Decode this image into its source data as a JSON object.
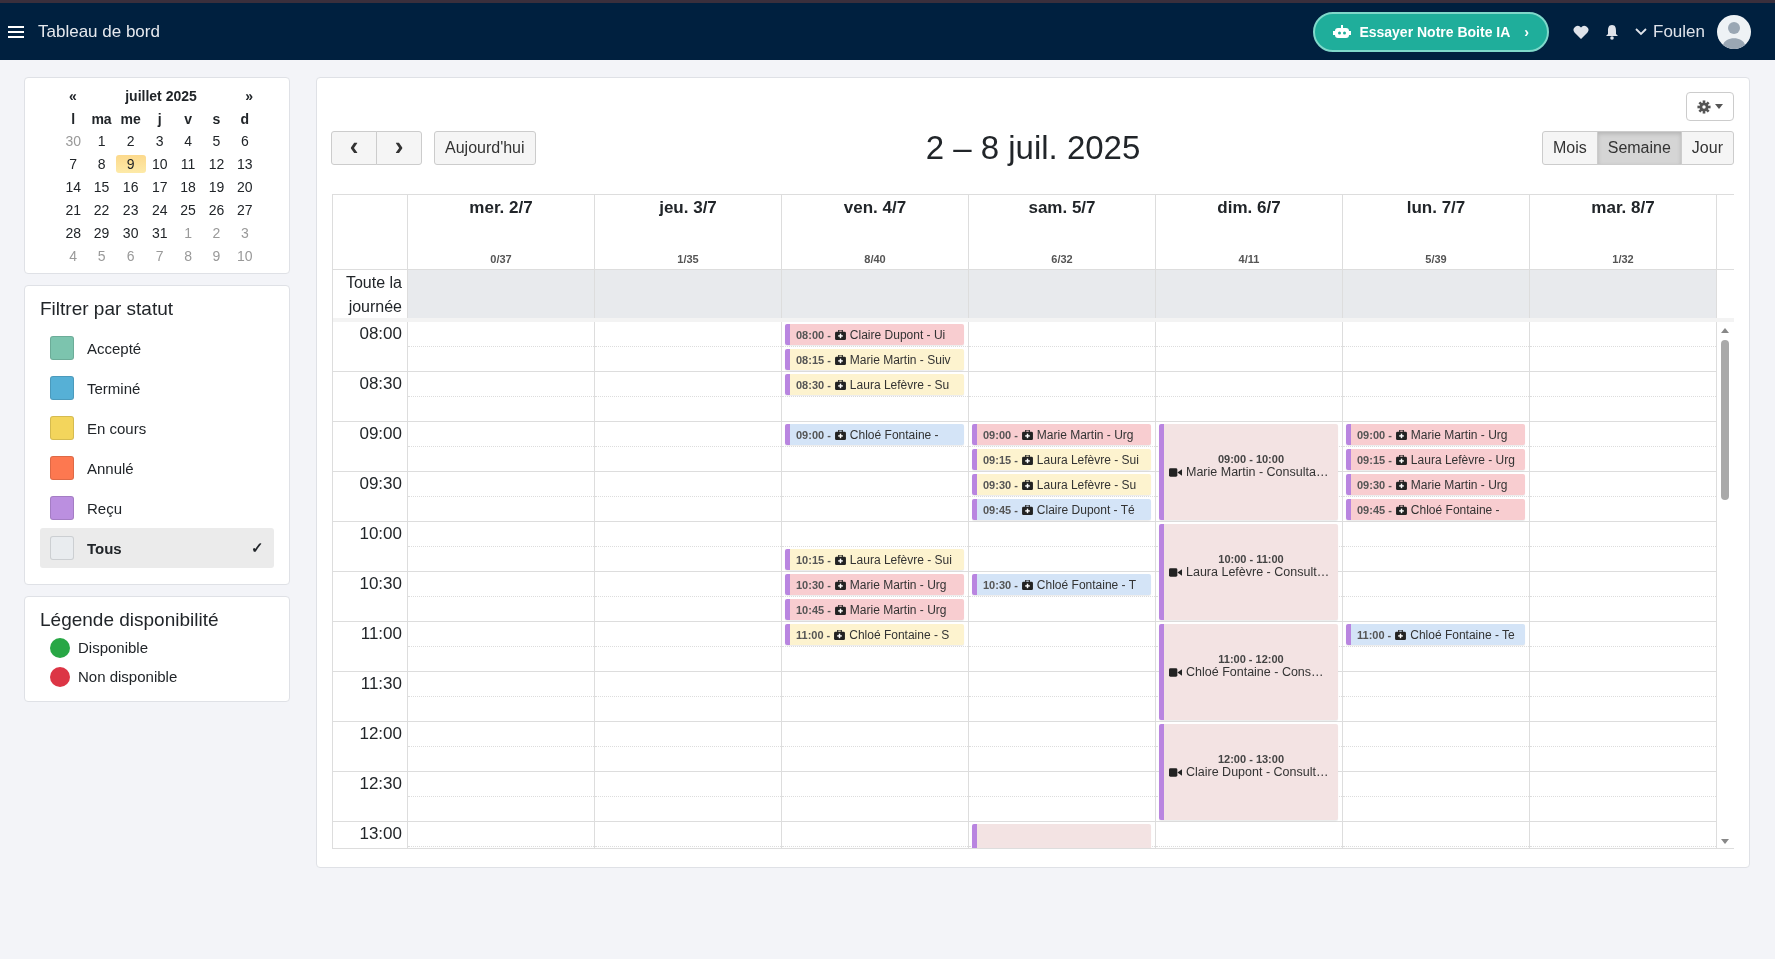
{
  "topbar": {
    "title": "Tableau de bord",
    "ai_button": "Essayer Notre Boite IA",
    "ai_chevron": "›",
    "user": "Foulen"
  },
  "mini_calendar": {
    "prev": "«",
    "title": "juillet 2025",
    "next": "»",
    "weekdays": [
      "l",
      "ma",
      "me",
      "j",
      "v",
      "s",
      "d"
    ],
    "weeks": [
      [
        {
          "day": "30",
          "muted": true,
          "selected": false
        },
        {
          "day": "1",
          "muted": false,
          "selected": false
        },
        {
          "day": "2",
          "muted": false,
          "selected": false
        },
        {
          "day": "3",
          "muted": false,
          "selected": false
        },
        {
          "day": "4",
          "muted": false,
          "selected": false
        },
        {
          "day": "5",
          "muted": false,
          "selected": false
        },
        {
          "day": "6",
          "muted": false,
          "selected": false
        }
      ],
      [
        {
          "day": "7",
          "muted": false,
          "selected": false
        },
        {
          "day": "8",
          "muted": false,
          "selected": false
        },
        {
          "day": "9",
          "muted": false,
          "selected": true
        },
        {
          "day": "10",
          "muted": false,
          "selected": false
        },
        {
          "day": "11",
          "muted": false,
          "selected": false
        },
        {
          "day": "12",
          "muted": false,
          "selected": false
        },
        {
          "day": "13",
          "muted": false,
          "selected": false
        }
      ],
      [
        {
          "day": "14",
          "muted": false,
          "selected": false
        },
        {
          "day": "15",
          "muted": false,
          "selected": false
        },
        {
          "day": "16",
          "muted": false,
          "selected": false
        },
        {
          "day": "17",
          "muted": false,
          "selected": false
        },
        {
          "day": "18",
          "muted": false,
          "selected": false
        },
        {
          "day": "19",
          "muted": false,
          "selected": false
        },
        {
          "day": "20",
          "muted": false,
          "selected": false
        }
      ],
      [
        {
          "day": "21",
          "muted": false,
          "selected": false
        },
        {
          "day": "22",
          "muted": false,
          "selected": false
        },
        {
          "day": "23",
          "muted": false,
          "selected": false
        },
        {
          "day": "24",
          "muted": false,
          "selected": false
        },
        {
          "day": "25",
          "muted": false,
          "selected": false
        },
        {
          "day": "26",
          "muted": false,
          "selected": false
        },
        {
          "day": "27",
          "muted": false,
          "selected": false
        }
      ],
      [
        {
          "day": "28",
          "muted": false,
          "selected": false
        },
        {
          "day": "29",
          "muted": false,
          "selected": false
        },
        {
          "day": "30",
          "muted": false,
          "selected": false
        },
        {
          "day": "31",
          "muted": false,
          "selected": false
        },
        {
          "day": "1",
          "muted": true,
          "selected": false
        },
        {
          "day": "2",
          "muted": true,
          "selected": false
        },
        {
          "day": "3",
          "muted": true,
          "selected": false
        }
      ],
      [
        {
          "day": "4",
          "muted": true,
          "selected": false
        },
        {
          "day": "5",
          "muted": true,
          "selected": false
        },
        {
          "day": "6",
          "muted": true,
          "selected": false
        },
        {
          "day": "7",
          "muted": true,
          "selected": false
        },
        {
          "day": "8",
          "muted": true,
          "selected": false
        },
        {
          "day": "9",
          "muted": true,
          "selected": false
        },
        {
          "day": "10",
          "muted": true,
          "selected": false
        }
      ]
    ]
  },
  "status_filter": {
    "title": "Filtrer par statut",
    "items": [
      {
        "label": "Accepté",
        "color": "#7cc4ae",
        "selected": false
      },
      {
        "label": "Terminé",
        "color": "#56b0d6",
        "selected": false
      },
      {
        "label": "En cours",
        "color": "#f3d55c",
        "selected": false
      },
      {
        "label": "Annulé",
        "color": "#fd7850",
        "selected": false
      },
      {
        "label": "Reçu",
        "color": "#bb8fe0",
        "selected": false
      },
      {
        "label": "Tous",
        "color": "#e9ecef",
        "selected": true,
        "check": "✓"
      }
    ]
  },
  "availability_legend": {
    "title": "Légende disponibilité",
    "items": [
      {
        "label": "Disponible",
        "color": "#28a745"
      },
      {
        "label": "Non disponible",
        "color": "#dc3545"
      }
    ]
  },
  "calendar": {
    "prev": "‹",
    "next": "›",
    "today": "Aujourd'hui",
    "title": "2 – 8 juil. 2025",
    "views": [
      {
        "label": "Mois",
        "selected": false
      },
      {
        "label": "Semaine",
        "selected": true
      },
      {
        "label": "Jour",
        "selected": false
      }
    ],
    "all_day_label": "Toute la journée",
    "times": [
      "08:00",
      "08:30",
      "09:00",
      "09:30",
      "10:00",
      "10:30",
      "11:00",
      "11:30",
      "12:00",
      "12:30",
      "13:00"
    ],
    "days": [
      {
        "name": "mer. 2/7",
        "count": "0/37"
      },
      {
        "name": "jeu. 3/7",
        "count": "1/35"
      },
      {
        "name": "ven. 4/7",
        "count": "8/40",
        "events": [
          {
            "kind": "short",
            "time": "08:00 -",
            "title": "Claire Dupont - Ui",
            "color": "#f8cdd0"
          },
          {
            "kind": "short",
            "time": "08:15 -",
            "title": "Marie Martin - Suiv",
            "color": "#fdf3cf"
          },
          {
            "kind": "short",
            "time": "08:30 -",
            "title": "Laura Lefèvre - Su",
            "color": "#fdf3cf"
          },
          {
            "kind": "short",
            "time": "09:00 -",
            "title": "Chloé Fontaine -",
            "color": "#d4e4f7"
          },
          {
            "kind": "short",
            "time": "10:15 -",
            "title": "Laura Lefèvre - Sui",
            "color": "#fdf3cf"
          },
          {
            "kind": "short",
            "time": "10:30 -",
            "title": "Marie Martin - Urg",
            "color": "#f8cdd0"
          },
          {
            "kind": "short",
            "time": "10:45 -",
            "title": "Marie Martin - Urg",
            "color": "#f8cdd0"
          },
          {
            "kind": "short",
            "time": "11:00 -",
            "title": "Chloé Fontaine - S",
            "color": "#fdf3cf"
          }
        ]
      },
      {
        "name": "sam. 5/7",
        "count": "6/32",
        "overflow_event": {
          "color": "#f3e3e3"
        },
        "events": [
          {
            "kind": "short",
            "time": "09:00 -",
            "title": "Marie Martin - Urg",
            "color": "#f8cdd0"
          },
          {
            "kind": "short",
            "time": "09:15 -",
            "title": "Laura Lefèvre - Sui",
            "color": "#fdf3cf"
          },
          {
            "kind": "short",
            "time": "09:30 -",
            "title": "Laura Lefèvre - Su",
            "color": "#fdf3cf"
          },
          {
            "kind": "short",
            "time": "09:45 -",
            "title": "Claire Dupont - Té",
            "color": "#d4e4f7"
          },
          {
            "kind": "short",
            "time": "10:30 -",
            "title": "Chloé Fontaine - T",
            "color": "#d4e4f7"
          }
        ]
      },
      {
        "name": "dim. 6/7",
        "count": "4/11",
        "events": [
          {
            "kind": "block",
            "time": "09:00 - 10:00",
            "title": "Marie Martin - Consulta…",
            "color": "#f3e3e3"
          },
          {
            "kind": "block",
            "time": "10:00 - 11:00",
            "title": "Laura Lefèvre - Consult…",
            "color": "#f3e3e3"
          },
          {
            "kind": "block",
            "time": "11:00 - 12:00",
            "title": "Chloé Fontaine - Cons…",
            "color": "#f3e3e3"
          },
          {
            "kind": "block",
            "time": "12:00 - 13:00",
            "title": "Claire Dupont - Consult…",
            "color": "#f3e3e3"
          }
        ]
      },
      {
        "name": "lun. 7/7",
        "count": "5/39",
        "events": [
          {
            "kind": "short",
            "time": "09:00 -",
            "title": "Marie Martin - Urg",
            "color": "#f8cdd0"
          },
          {
            "kind": "short",
            "time": "09:15 -",
            "title": "Laura Lefèvre - Urg",
            "color": "#f8cdd0"
          },
          {
            "kind": "short",
            "time": "09:30 -",
            "title": "Marie Martin - Urg",
            "color": "#f8cdd0"
          },
          {
            "kind": "short",
            "time": "09:45 -",
            "title": "Chloé Fontaine -",
            "color": "#f8cdd0"
          },
          {
            "kind": "short",
            "time": "11:00 -",
            "title": "Chloé Fontaine - Te",
            "color": "#d4e4f7"
          }
        ]
      },
      {
        "name": "mar. 8/7",
        "count": "1/32"
      }
    ]
  }
}
